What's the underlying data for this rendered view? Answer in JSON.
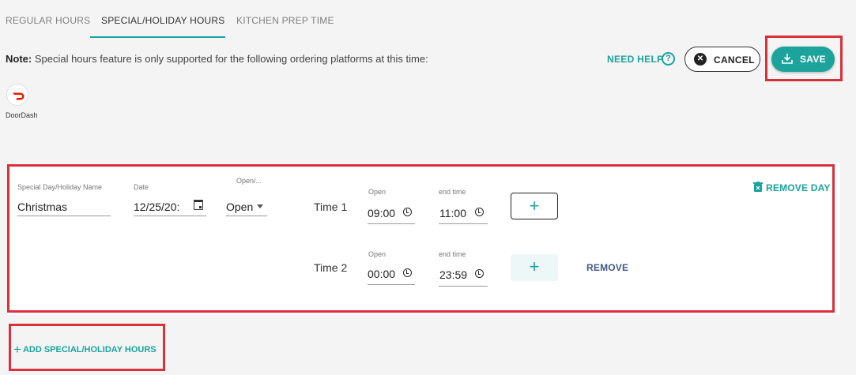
{
  "tabs": [
    {
      "label": "REGULAR HOURS",
      "active": false
    },
    {
      "label": "SPECIAL/HOLIDAY HOURS",
      "active": true
    },
    {
      "label": "KITCHEN PREP TIME",
      "active": false
    }
  ],
  "note": {
    "prefix": "Note:",
    "text": " Special hours feature is only supported for the following ordering platforms at this time:"
  },
  "header": {
    "need_help": "NEED HELP",
    "cancel": "CANCEL",
    "save": "SAVE"
  },
  "platforms": [
    {
      "name": "DoorDash",
      "icon": "doordash-logo"
    }
  ],
  "special_day": {
    "name_label": "Special Day/Holiday Name",
    "name_value": "Christmas",
    "date_label": "Date",
    "date_value": "12/25/20:",
    "open_label": "Open/...",
    "open_value": "Open",
    "remove_day": "REMOVE DAY",
    "times": [
      {
        "label": "Time 1",
        "open_label": "Open",
        "open_value": "09:00",
        "end_label": "end time",
        "end_value": "11:00",
        "add": "+"
      },
      {
        "label": "Time 2",
        "open_label": "Open",
        "open_value": "00:00",
        "end_label": "end time",
        "end_value": "23:59",
        "add": "+",
        "remove": "REMOVE"
      }
    ]
  },
  "add_hours": "ADD SPECIAL/HOLIDAY HOURS",
  "colors": {
    "accent": "#1ba39c",
    "highlight": "#d9303a",
    "link": "#3e5a8a"
  }
}
